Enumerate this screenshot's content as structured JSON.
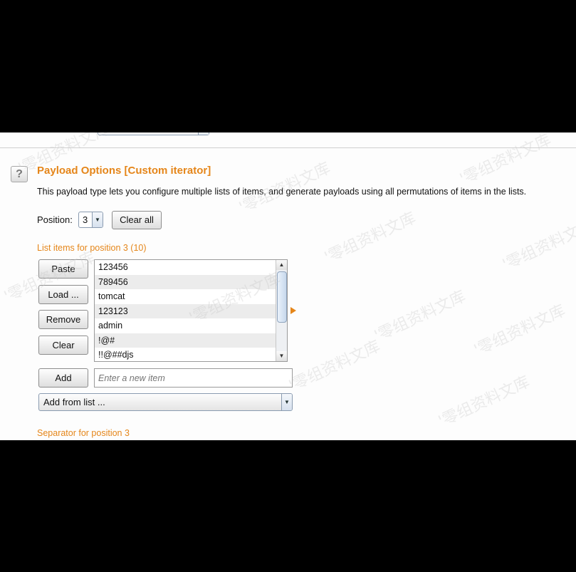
{
  "payload_options": {
    "help_glyph": "?",
    "title": "Payload Options [Custom iterator]",
    "description": "This payload type lets you configure multiple lists of items, and generate payloads using all permutations of items in the lists.",
    "position_label": "Position:",
    "position_value": "3",
    "clear_all_label": "Clear all",
    "list_header": "List items for position 3 (10)",
    "buttons": {
      "paste": "Paste",
      "load": "Load ...",
      "remove": "Remove",
      "clear": "Clear",
      "add": "Add"
    },
    "list_items": [
      "123456",
      "789456",
      "tomcat",
      "123123",
      "admin",
      "!@#",
      "!!@##djs"
    ],
    "new_item_placeholder": "Enter a new item",
    "add_from_list_value": "Add from list ...",
    "separator_label": "Separator for position 3"
  },
  "watermark_text": "'零组资料文库",
  "colors": {
    "accent": "#e5861a",
    "panel_bg": "#fdfdfd",
    "outer_bg": "#000000"
  },
  "icons": {
    "help": "question-mark-icon",
    "dropdown": "chevron-down-icon",
    "scroll_up": "triangle-up-icon",
    "scroll_down": "triangle-down-icon",
    "expand": "triangle-right-icon"
  }
}
